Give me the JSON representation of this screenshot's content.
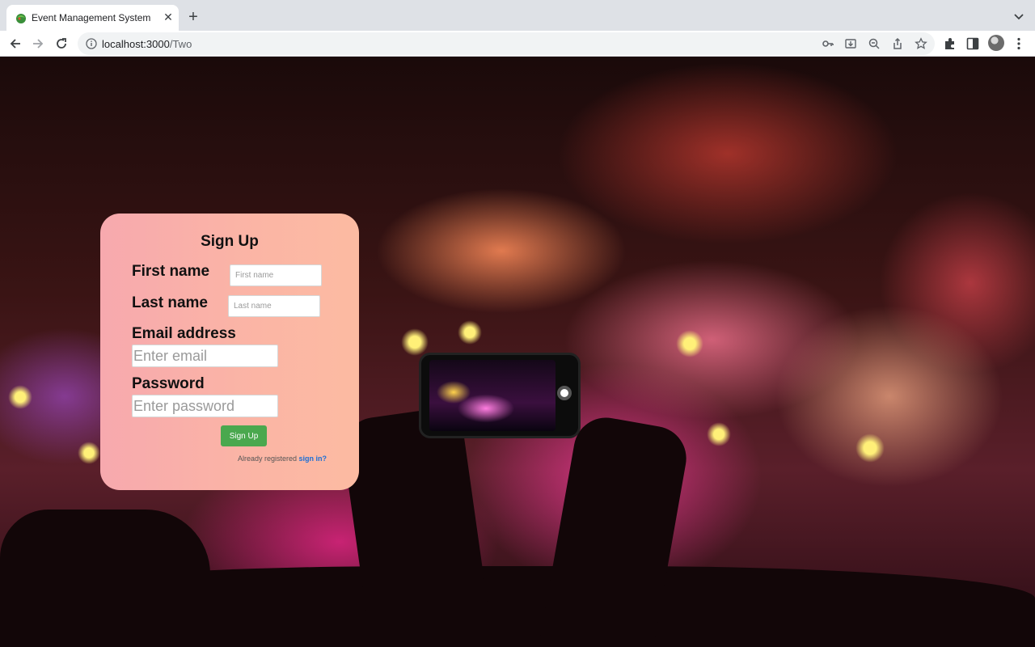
{
  "browser": {
    "tab_title": "Event Management System",
    "url_host": "localhost:3000",
    "url_path": "/Two"
  },
  "form": {
    "title": "Sign Up",
    "first_name_label": "First name",
    "first_name_placeholder": "First name",
    "last_name_label": "Last name",
    "last_name_placeholder": "Last name",
    "email_label": "Email address",
    "email_placeholder": "Enter email",
    "password_label": "Password",
    "password_placeholder": "Enter password",
    "submit_label": "Sign Up",
    "footer_text": "Already registered ",
    "footer_link": "sign in?"
  },
  "colors": {
    "submit_bg": "#4aa84e",
    "link": "#1b6fd6",
    "card_gradient_start": "#f7a9ae",
    "card_gradient_end": "#fcbba2"
  }
}
